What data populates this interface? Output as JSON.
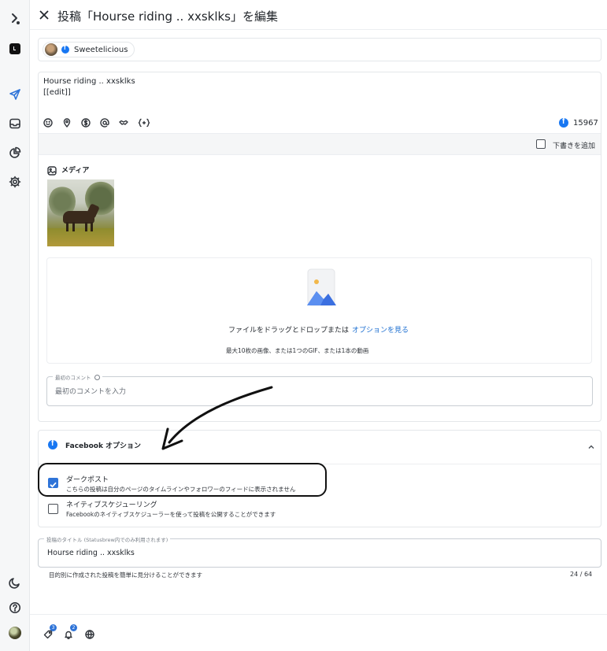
{
  "header": {
    "title": "投稿「Hourse riding .. xxsklks」を編集"
  },
  "account": {
    "name": "Sweetelicious"
  },
  "post": {
    "text": "Hourse riding .. xxsklks\n[[edit]]",
    "char_count": "15967"
  },
  "draft": {
    "label": "下書きを追加"
  },
  "media": {
    "title": "メディア",
    "drop_text": "ファイルをドラッグとドロップまたは",
    "drop_link": "オプションを見る",
    "drop_sub": "最大10枚の画像、または1つのGIF、または1本の動画"
  },
  "first_comment": {
    "label": "最初のコメント",
    "placeholder": "最初のコメントを入力"
  },
  "facebook_options": {
    "title": "Facebook オプション",
    "dark_post": {
      "label": "ダークポスト",
      "desc": "こちらの投稿は自分のページのタイムラインやフォロワーのフィードに表示されません"
    },
    "native_scheduling": {
      "label": "ネイティブスケジューリング",
      "desc": "Facebookのネイティブスケジューラーを使って投稿を公開することができます"
    }
  },
  "post_title": {
    "label": "投稿のタイトル (Statusbrew内でのみ利用されます)",
    "value": "Hourse riding .. xxsklks",
    "helper": "目的別に作成された投稿を簡単に見分けることができます",
    "count": "24 / 64"
  },
  "footer": {
    "tag_badge": "3",
    "bell_badge": "2"
  },
  "colors": {
    "accent": "#2f74d8",
    "facebook": "#1877f2"
  }
}
